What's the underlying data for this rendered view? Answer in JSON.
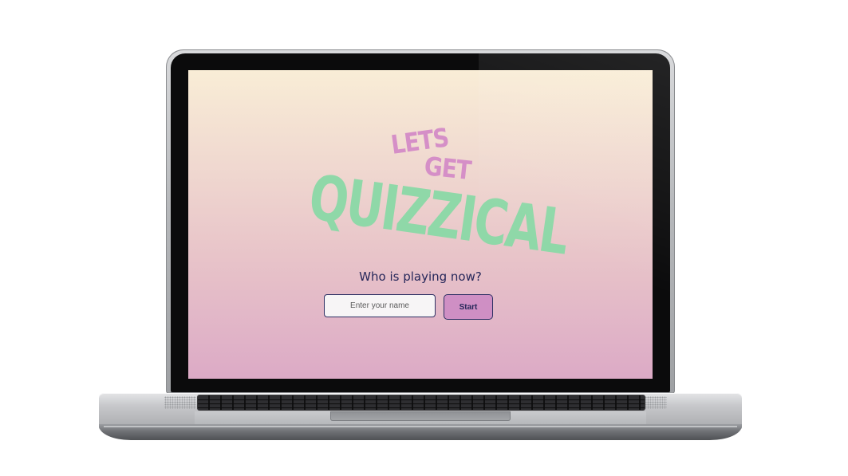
{
  "app": {
    "logo": {
      "line1": "LETS",
      "line2": "GET",
      "line3": "QUIZZICAL"
    },
    "prompt": "Who is playing now?",
    "name_input": {
      "value": "",
      "placeholder": "Enter your name"
    },
    "start_label": "Start"
  },
  "colors": {
    "background_top": "#f9edd6",
    "background_bottom": "#dcaac6",
    "logo_pink": "#d58fc7",
    "logo_green": "#8fd8a8",
    "text_navy": "#26275a",
    "button_fill": "#cf8fc4",
    "border_navy": "#2d2f63"
  },
  "device": {
    "type": "laptop"
  }
}
